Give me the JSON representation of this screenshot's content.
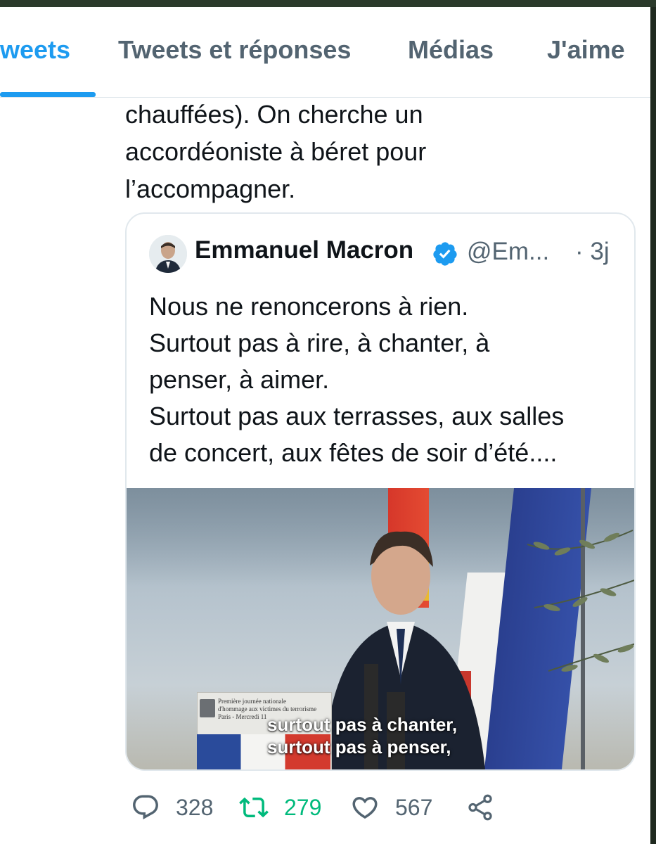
{
  "tabs": [
    {
      "label": "weets",
      "active": true
    },
    {
      "label": "Tweets et réponses",
      "active": false
    },
    {
      "label": "Médias",
      "active": false
    },
    {
      "label": "J'aime",
      "active": false
    }
  ],
  "tweet": {
    "text": "chauffées). On cherche un\naccordéoniste à béret pour\nl’accompagner."
  },
  "quoted_tweet": {
    "author_name": "Emmanuel Macron",
    "verified": true,
    "handle": "@Em...",
    "time": "· 3j",
    "text": "Nous ne renoncerons à rien.\nSurtout pas à rire, à chanter, à\npenser, à aimer.\nSurtout pas aux terrasses, aux salles\nde concert, aux fêtes de soir d’été....",
    "media": {
      "subtitle": "surtout pas à chanter,\nsurtout pas à penser,",
      "podium_text": "Première journée nationale\nd'hommage aux victimes du terrorisme\nParis - Mercredi 11"
    }
  },
  "actions": {
    "reply_icon": "reply-icon",
    "reply_count": "328",
    "retweet_icon": "retweet-icon",
    "retweet_count": "279",
    "like_icon": "heart-icon",
    "like_count": "567",
    "share_icon": "share-icon"
  },
  "colors": {
    "accent": "#1d9bf0",
    "retweet_green": "#00ba7c",
    "muted_text": "#536471",
    "verified_blue": "#1d9bf0"
  }
}
